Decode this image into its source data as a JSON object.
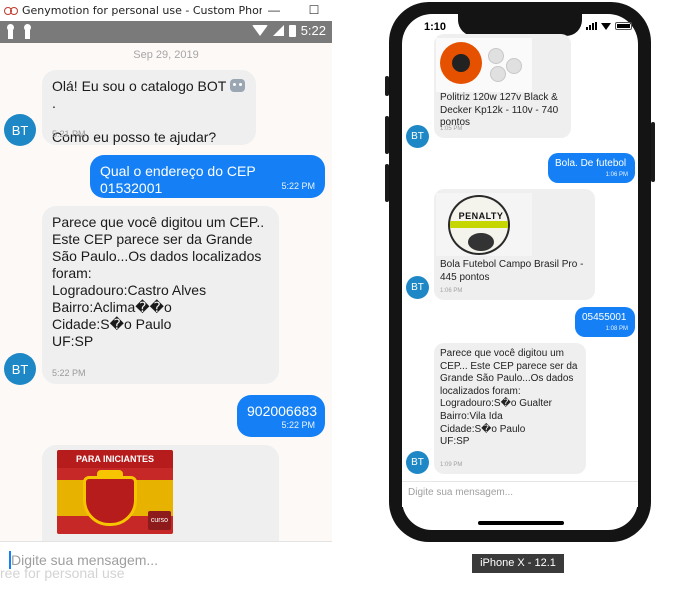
{
  "genymotion": {
    "window_title": "Genymotion for personal use - Custom Phone - ...",
    "minimize_label": "—",
    "maximize_label": "☐",
    "status_time": "5:22"
  },
  "android_chat": {
    "date_separator": "Sep 29, 2019",
    "avatar_text": "BT",
    "messages": [
      {
        "from": "bot",
        "text_line1": "Olá! Eu sou o catalogo BOT",
        "text_line1_end": " .",
        "text_line2": "Como eu posso te ajudar?",
        "time": "5:21 PM"
      },
      {
        "from": "user",
        "text": "Qual o endereço do CEP 01532001",
        "time": "5:22 PM"
      },
      {
        "from": "bot",
        "text": "Parece que você digitou um CEP..\nEste CEP parece ser da Grande\nSão Paulo...Os dados localizados\nforam:\nLogradouro:Castro Alves\nBairro:Aclima��o\nCidade:S�o Paulo\nUF:SP",
        "time": "5:22 PM"
      },
      {
        "from": "user",
        "text": "902006683",
        "time": "5:22 PM"
      },
      {
        "from": "bot",
        "image_caption": "PARA INICIANTES",
        "image_badge": "curso"
      }
    ],
    "input_placeholder": "Digite sua mensagem...",
    "watermark": "ree for personal use"
  },
  "ios": {
    "status_time": "1:10",
    "avatar_text": "BT",
    "messages": [
      {
        "from": "bot",
        "text": "Politriz 120w 127v  Black &\nDecker Kp12k - 110v - 740\npontos",
        "time": "1:05 PM"
      },
      {
        "from": "user",
        "text": "Bola. De futebol",
        "time": "1:06 PM"
      },
      {
        "from": "bot",
        "image_text": "PENALTY",
        "text": "Bola Futebol Campo Brasil Pro -\n445 pontos",
        "time": "1:06 PM"
      },
      {
        "from": "user",
        "text": "05455001",
        "time": "1:08 PM"
      },
      {
        "from": "bot",
        "text": "Parece que você digitou um\nCEP... Este CEP parece ser da\nGrande São Paulo...Os dados\nlocalizados foram:\nLogradouro:S�o Gualter\nBairro:Vila Ida\nCidade:S�o Paulo\nUF:SP",
        "time": "1:09 PM"
      }
    ],
    "input_placeholder": "Digite sua mensagem...",
    "device_label": "iPhone X - 12.1"
  }
}
